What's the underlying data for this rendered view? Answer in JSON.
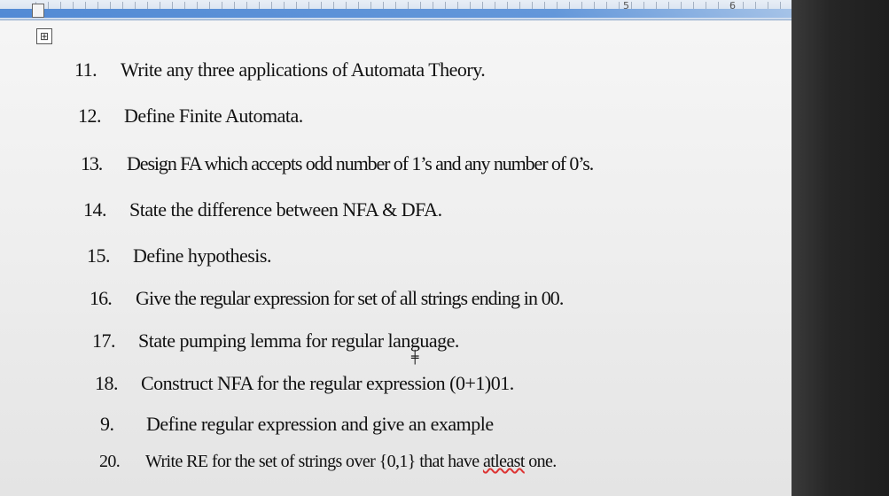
{
  "ruler": {
    "number_5": "5",
    "number_6": "6"
  },
  "document": {
    "handle_glyph": "⊞",
    "questions": [
      {
        "num": "11.",
        "text": "Write any three applications of Automata Theory."
      },
      {
        "num": "12.",
        "text": "Define Finite Automata."
      },
      {
        "num": "13.",
        "text": "Design FA which accepts odd number of 1’s and any number of 0’s."
      },
      {
        "num": "14.",
        "text": "State the difference between NFA & DFA."
      },
      {
        "num": "15.",
        "text": "Define hypothesis."
      },
      {
        "num": "16.",
        "text": "Give the regular expression for set of all strings ending in 00."
      },
      {
        "num": "17.",
        "text": "State pumping lemma for regular language."
      },
      {
        "num": "18.",
        "text": "Construct NFA for the regular expression (0+1)01."
      },
      {
        "num": "9.",
        "text": "Define regular expression and give an example"
      },
      {
        "num": "20.",
        "text_before": "Write RE for the set of strings over {0,1} that have ",
        "text_spell": "atleast",
        "text_after": " one."
      }
    ]
  },
  "colors": {
    "ruler_blue": "#4f8ad6",
    "paper": "#f0f0f0",
    "bezel": "#262626",
    "text": "#111111",
    "spellcheck": "#dd3333"
  }
}
